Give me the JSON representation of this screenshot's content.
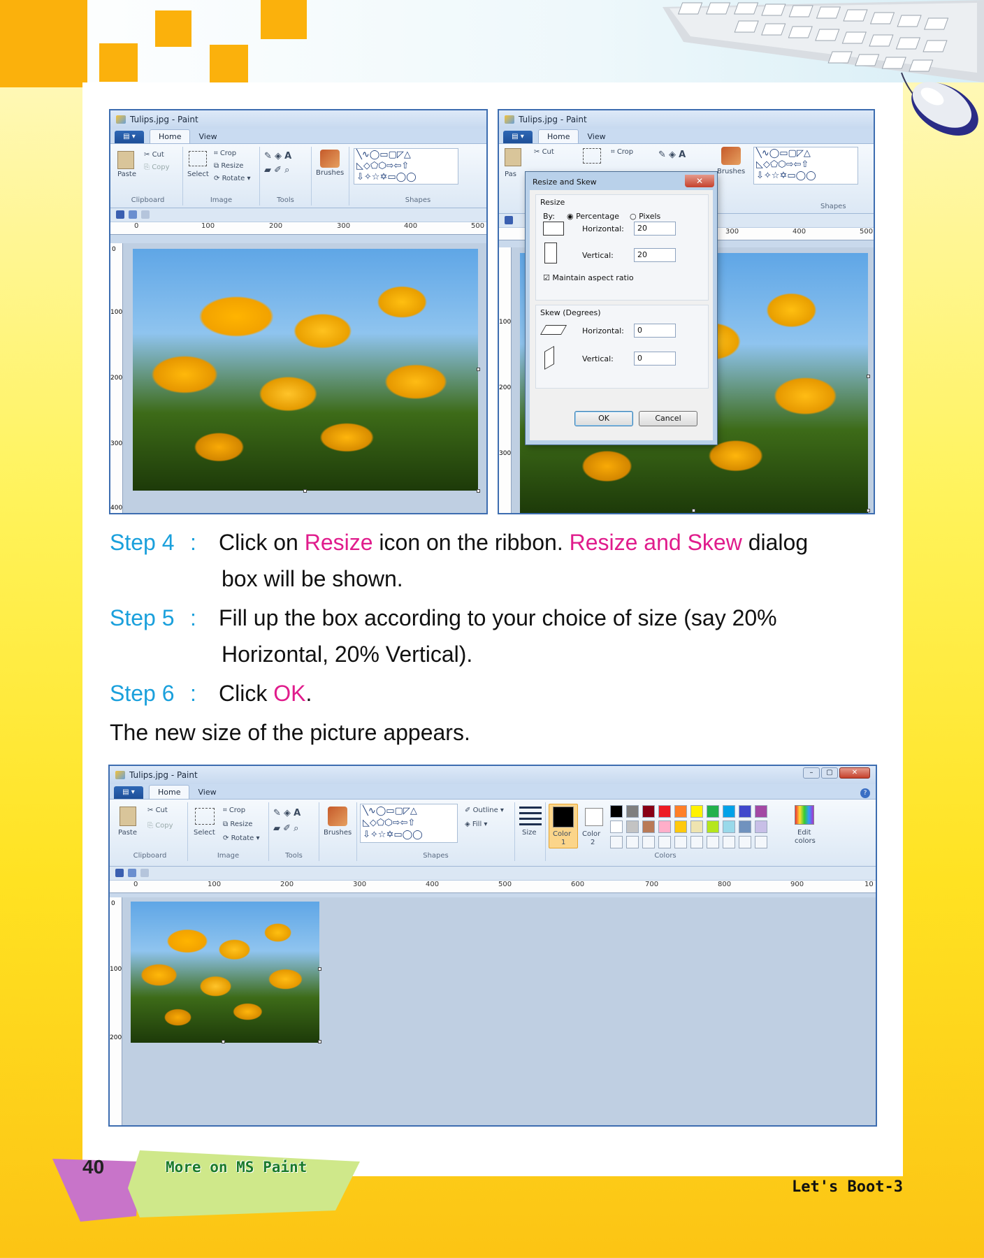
{
  "paint_top_left": {
    "title": "Tulips.jpg - Paint",
    "tabs": [
      "Home",
      "View"
    ],
    "clipboard": {
      "paste": "Paste",
      "cut": "Cut",
      "copy": "Copy",
      "label": "Clipboard"
    },
    "image": {
      "select": "Select",
      "crop": "Crop",
      "resize": "Resize",
      "rotate": "Rotate",
      "label": "Image"
    },
    "tools_label": "Tools",
    "brushes": "Brushes",
    "shapes_label": "Shapes",
    "ruler_h": [
      "0",
      "100",
      "200",
      "300",
      "400",
      "500"
    ],
    "ruler_v": [
      "0",
      "100",
      "200",
      "300",
      "400"
    ]
  },
  "paint_top_right": {
    "title": "Tulips.jpg - Paint",
    "tabs": [
      "Home",
      "View"
    ],
    "cut": "Cut",
    "crop": "Crop",
    "paste_partial": "Pas",
    "brushes": "Brushes",
    "shapes_label": "Shapes",
    "ruler_h": [
      "300",
      "400",
      "500"
    ],
    "ruler_v": [
      "100",
      "200",
      "300"
    ],
    "dialog": {
      "title": "Resize and Skew",
      "resize_label": "Resize",
      "by_label": "By:",
      "percentage": "Percentage",
      "pixels": "Pixels",
      "horizontal_label": "Horizontal:",
      "vertical_label": "Vertical:",
      "resize_horizontal": "20",
      "resize_vertical": "20",
      "maintain": "Maintain aspect ratio",
      "skew_label": "Skew (Degrees)",
      "skew_horizontal": "0",
      "skew_vertical": "0",
      "ok": "OK",
      "cancel": "Cancel"
    }
  },
  "steps": [
    {
      "label": "Step 4",
      "colon": ":",
      "pre": "Click on ",
      "hl1": "Resize",
      "mid": " icon on the ribbon. ",
      "hl2": "Resize and Skew",
      "post": " dialog",
      "line2": "box will be shown."
    },
    {
      "label": "Step 5",
      "colon": ":",
      "line1": "Fill up the box according to your choice of size (say 20%",
      "line2": "Horizontal, 20% Vertical)."
    },
    {
      "label": "Step 6",
      "colon": ":",
      "pre": "Click ",
      "hl1": "OK",
      "post": "."
    }
  ],
  "result_text": "The new size of the picture appears.",
  "paint_bottom": {
    "title": "Tulips.jpg - Paint",
    "tabs": [
      "Home",
      "View"
    ],
    "clipboard": {
      "paste": "Paste",
      "cut": "Cut",
      "copy": "Copy",
      "label": "Clipboard"
    },
    "image": {
      "select": "Select",
      "crop": "Crop",
      "resize": "Resize",
      "rotate": "Rotate",
      "label": "Image"
    },
    "tools_label": "Tools",
    "brushes": "Brushes",
    "shapes_label": "Shapes",
    "outline": "Outline",
    "fill": "Fill",
    "size": "Size",
    "color1": "Color",
    "color1_num": "1",
    "color2": "Color",
    "color2_num": "2",
    "colors_label": "Colors",
    "edit_colors": "Edit",
    "edit_colors2": "colors",
    "ruler_h": [
      "0",
      "100",
      "200",
      "300",
      "400",
      "500",
      "600",
      "700",
      "800",
      "900",
      "10"
    ],
    "ruler_v": [
      "0",
      "100",
      "200"
    ],
    "palette_row1": [
      "#000000",
      "#7f7f7f",
      "#880015",
      "#ed1c24",
      "#ff7f27",
      "#fff200",
      "#22b14c",
      "#00a2e8",
      "#3f48cc",
      "#a349a4"
    ],
    "palette_row2": [
      "#ffffff",
      "#c3c3c3",
      "#b97a57",
      "#ffaec9",
      "#ffc90e",
      "#efe4b0",
      "#b5e61d",
      "#99d9ea",
      "#7092be",
      "#c8bfe7"
    ]
  },
  "footer": {
    "page_number": "40",
    "chapter": "More on MS Paint",
    "book": "Let's Boot-3"
  },
  "colors": {
    "step_blue": "#1aa0dc",
    "highlight_pink": "#e01c8c",
    "orange": "#fbb10c"
  }
}
